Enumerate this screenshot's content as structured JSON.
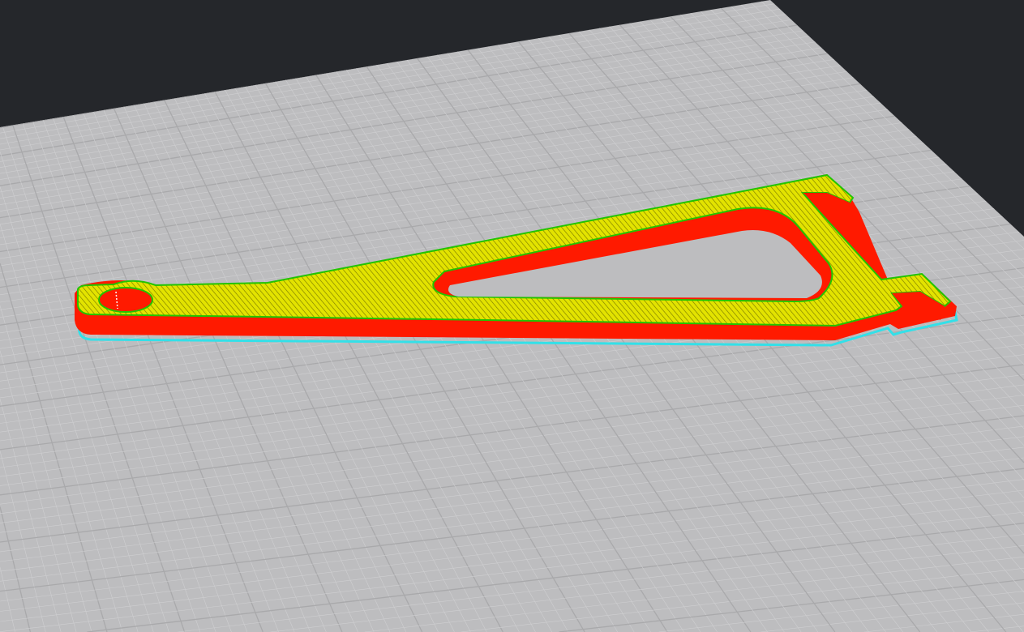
{
  "scene": {
    "background_color": "#25272b",
    "bed_color": "#bdbdbf",
    "grid_minor_color": "#cfcfd1",
    "grid_major_color": "#a9a9ab",
    "colors": {
      "top_infill": "#e3e300",
      "infill_lines": "#6b6b00",
      "perimeter": "#ff1a00",
      "outer_edge": "#22c400",
      "skirt": "#33e0e8"
    }
  }
}
